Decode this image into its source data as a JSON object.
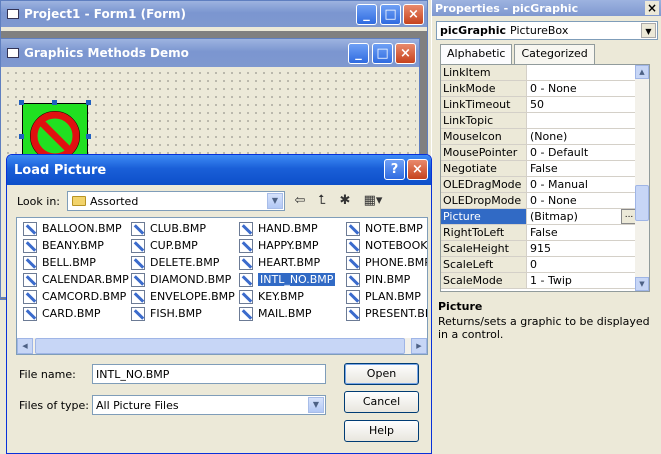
{
  "project_window": {
    "title": "Project1 - Form1 (Form)"
  },
  "form_window": {
    "title": "Graphics Methods Demo"
  },
  "properties": {
    "title": "Properties - picGraphic",
    "close_glyph": "×",
    "object_name": "picGraphic",
    "object_type": "PictureBox",
    "tabs": [
      "Alphabetic",
      "Categorized"
    ],
    "rows": [
      {
        "name": "LinkItem",
        "value": ""
      },
      {
        "name": "LinkMode",
        "value": "0 - None"
      },
      {
        "name": "LinkTimeout",
        "value": "50"
      },
      {
        "name": "LinkTopic",
        "value": ""
      },
      {
        "name": "MouseIcon",
        "value": "(None)"
      },
      {
        "name": "MousePointer",
        "value": "0 - Default"
      },
      {
        "name": "Negotiate",
        "value": "False"
      },
      {
        "name": "OLEDragMode",
        "value": "0 - Manual"
      },
      {
        "name": "OLEDropMode",
        "value": "0 - None"
      },
      {
        "name": "Picture",
        "value": "(Bitmap)"
      },
      {
        "name": "RightToLeft",
        "value": "False"
      },
      {
        "name": "ScaleHeight",
        "value": "915"
      },
      {
        "name": "ScaleLeft",
        "value": "0"
      },
      {
        "name": "ScaleMode",
        "value": "1 - Twip"
      }
    ],
    "selected_row": "Picture",
    "description_title": "Picture",
    "description_text": "Returns/sets a graphic to be displayed in a control."
  },
  "dialog": {
    "title": "Load Picture",
    "look_in_label": "Look in:",
    "look_in_value": "Assorted",
    "files": [
      [
        "BALLOON.BMP",
        "BEANY.BMP",
        "BELL.BMP",
        "CALENDAR.BMP",
        "CAMCORD.BMP",
        "CARD.BMP"
      ],
      [
        "CLUB.BMP",
        "CUP.BMP",
        "DELETE.BMP",
        "DIAMOND.BMP",
        "ENVELOPE.BMP",
        "FISH.BMP"
      ],
      [
        "HAND.BMP",
        "HAPPY.BMP",
        "HEART.BMP",
        "INTL_NO.BMP",
        "KEY.BMP",
        "MAIL.BMP"
      ],
      [
        "NOTE.BMP",
        "NOTEBOOK.B",
        "PHONE.BMP",
        "PIN.BMP",
        "PLAN.BMP",
        "PRESENT.BMP"
      ]
    ],
    "selected_file": "INTL_NO.BMP",
    "file_name_label": "File name:",
    "file_name_value": "INTL_NO.BMP",
    "file_type_label": "Files of type:",
    "file_type_value": "All Picture Files",
    "buttons": {
      "open": "Open",
      "cancel": "Cancel",
      "help": "Help"
    }
  }
}
